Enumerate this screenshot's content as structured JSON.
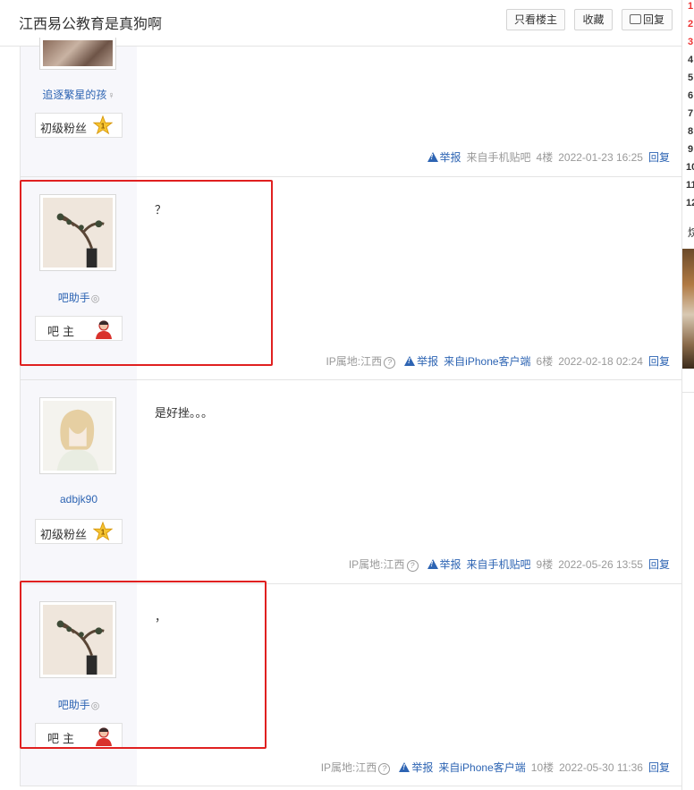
{
  "header": {
    "title": "江西易公教育是真狗啊",
    "only_author_label": "只看楼主",
    "favorite_label": "收藏",
    "reply_label": "回复"
  },
  "sidebar": {
    "ranks": [
      {
        "num": "1",
        "color": "#e33"
      },
      {
        "num": "2",
        "color": "#e33"
      },
      {
        "num": "3",
        "color": "#e33"
      },
      {
        "num": "4",
        "color": "#333"
      },
      {
        "num": "5",
        "color": "#333"
      },
      {
        "num": "6",
        "color": "#333"
      },
      {
        "num": "7",
        "color": "#333"
      },
      {
        "num": "8",
        "color": "#333"
      },
      {
        "num": "9",
        "color": "#333"
      },
      {
        "num": "10",
        "color": "#333"
      },
      {
        "num": "11",
        "color": "#333"
      },
      {
        "num": "12",
        "color": "#333"
      }
    ],
    "section_char": "烷"
  },
  "posts": [
    {
      "username": "追逐繁星的孩",
      "user_mark": "♀",
      "badge": "初级粉丝",
      "badge_icon": "star-level-1-icon",
      "content": "",
      "ip": "",
      "report": "举报",
      "client": "来自手机贴吧",
      "floor": "4楼",
      "time": "2022-01-23 16:25",
      "reply": "回复"
    },
    {
      "username": "吧助手",
      "user_mark": "◎",
      "badge": "吧主",
      "badge_icon": "moderator-person-icon",
      "content": "？",
      "ip": "IP属地:江西",
      "report": "举报",
      "client": "来自iPhone客户端",
      "floor": "6楼",
      "time": "2022-02-18 02:24",
      "reply": "回复"
    },
    {
      "username": "adbjk90",
      "user_mark": "",
      "badge": "初级粉丝",
      "badge_icon": "star-level-1-icon",
      "content": "是好挫。。。",
      "ip": "IP属地:江西",
      "report": "举报",
      "client": "来自手机贴吧",
      "floor": "9楼",
      "time": "2022-05-26 13:55",
      "reply": "回复"
    },
    {
      "username": "吧助手",
      "user_mark": "◎",
      "badge": "吧主",
      "badge_icon": "moderator-person-icon",
      "content": "，",
      "ip": "IP属地:江西",
      "report": "举报",
      "client": "来自iPhone客户端",
      "floor": "10楼",
      "time": "2022-05-30 11:36",
      "reply": "回复"
    }
  ],
  "colors": {
    "link": "#2d64b3",
    "highlight_box": "#e02020",
    "user_column_bg": "#f7f7fb"
  }
}
